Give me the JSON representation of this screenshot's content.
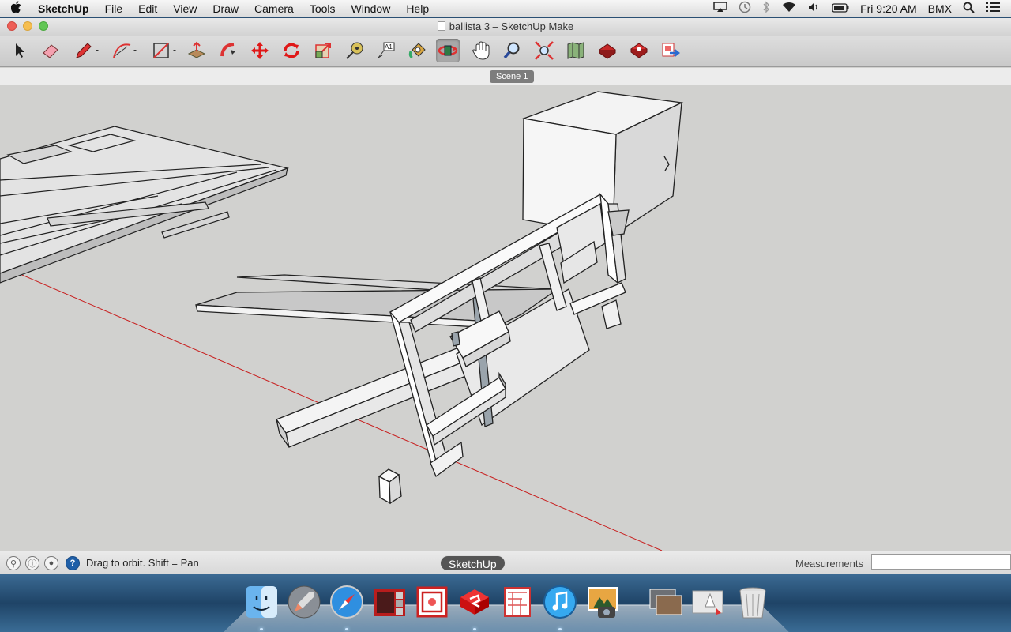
{
  "menubar": {
    "app_name": "SketchUp",
    "menus": [
      "File",
      "Edit",
      "View",
      "Draw",
      "Camera",
      "Tools",
      "Window",
      "Help"
    ],
    "clock": "Fri 9:20 AM",
    "user": "BMX"
  },
  "window": {
    "title": "ballista 3 – SketchUp Make"
  },
  "toolbar": {
    "tools": [
      "select-tool",
      "eraser-tool",
      "pencil-tool",
      "arc-tool",
      "rectangle-tool",
      "push-pull-tool",
      "follow-me-tool",
      "move-tool",
      "rotate-tool",
      "scale-tool",
      "tape-measure-tool",
      "text-tool",
      "paint-bucket-tool",
      "orbit-tool",
      "pan-tool",
      "zoom-tool",
      "zoom-extents-tool",
      "3d-warehouse-tool",
      "share-model-tool",
      "extension-warehouse-tool",
      "layout-send-tool"
    ],
    "active": "orbit-tool"
  },
  "scenes": {
    "tabs": [
      "Scene 1"
    ]
  },
  "statusbar": {
    "hint": "Drag to orbit.  Shift = Pan",
    "measurements_label": "Measurements",
    "measurements_value": ""
  },
  "dock": {
    "tooltip": "SketchUp",
    "apps": [
      "Finder",
      "Launchpad",
      "Safari",
      "Photo Booth",
      "LayOut",
      "SketchUp",
      "Style Builder",
      "iTunes",
      "iPhoto",
      "Downloads",
      "Documents",
      "Trash"
    ]
  }
}
